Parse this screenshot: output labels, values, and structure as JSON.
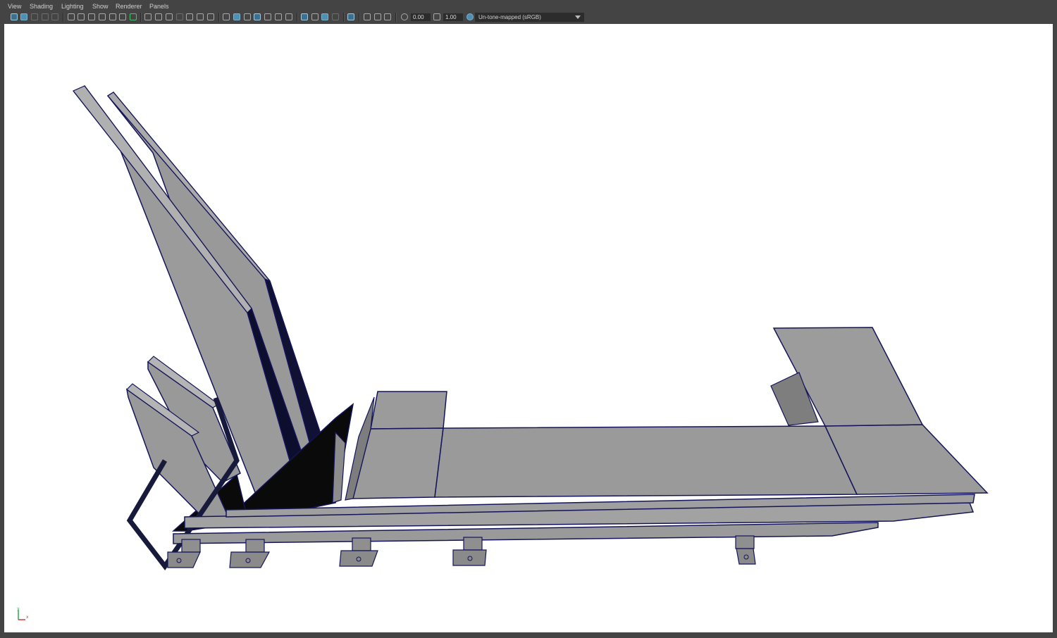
{
  "menubar": {
    "items": [
      "View",
      "Shading",
      "Lighting",
      "Show",
      "Renderer",
      "Panels"
    ]
  },
  "toolbar": {
    "exposure_value": "0.00",
    "gamma_value": "1.00",
    "colorspace_label": "Un-tone-mapped (sRGB)"
  },
  "viewport": {
    "background": "#ffffff",
    "mesh_color": "#9a9a9a",
    "wire_color": "#14145a"
  },
  "axis": {
    "y_label": "y",
    "x_label": "x",
    "y_color": "#2ea84a",
    "x_color": "#d23b3b"
  }
}
